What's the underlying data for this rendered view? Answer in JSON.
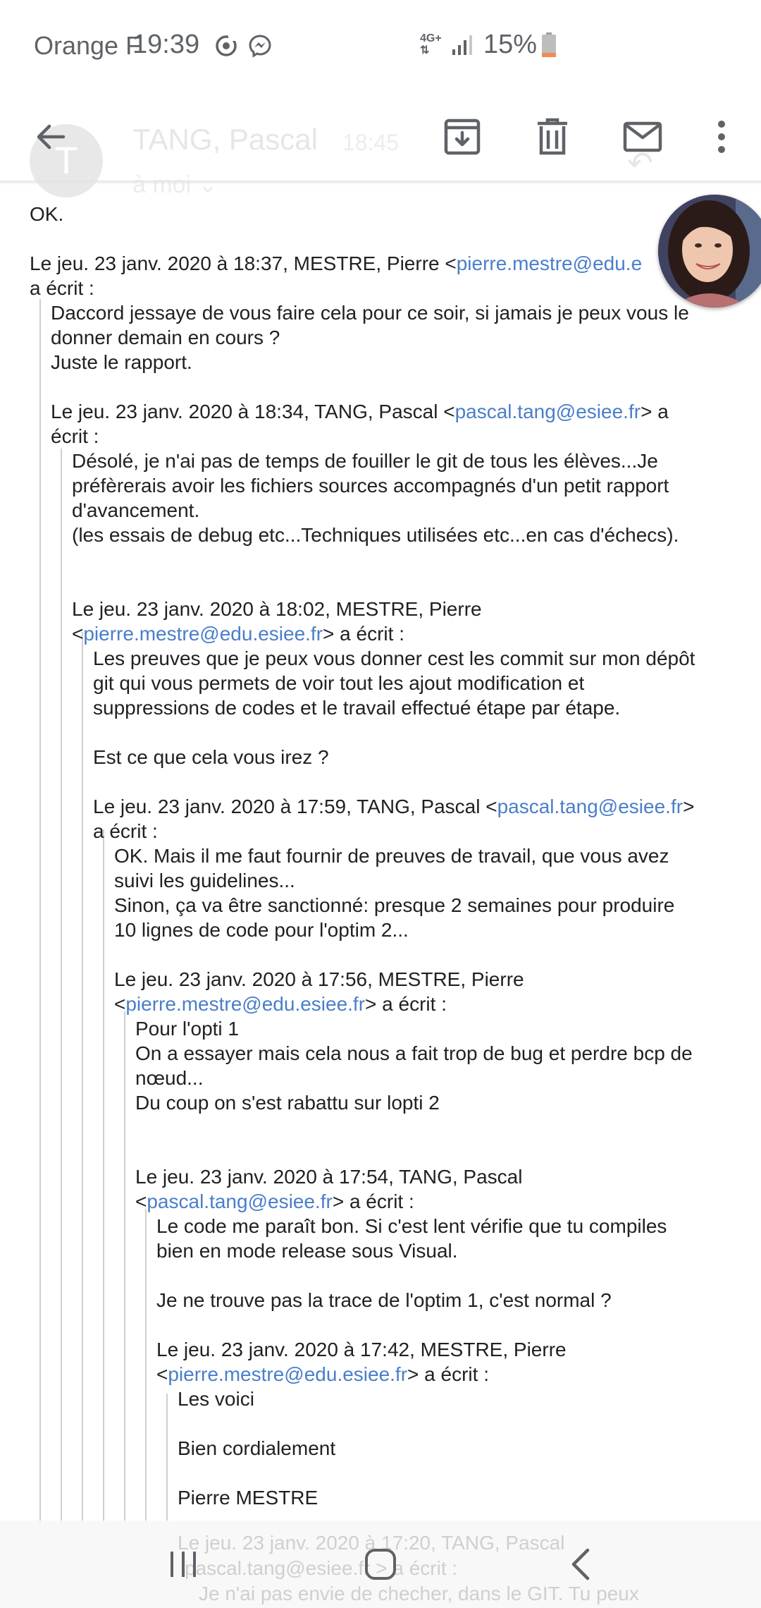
{
  "status_bar": {
    "carrier": "Orange F",
    "time": "19:39",
    "network": "4G+",
    "battery": "15%"
  },
  "faded_header": {
    "avatar_letter": "T",
    "sender": "TANG, Pascal",
    "time": "18:45",
    "to": "à moi"
  },
  "toolbar": {
    "back_icon": "arrow-back-icon",
    "archive_icon": "archive-icon",
    "delete_icon": "trash-icon",
    "unread_icon": "mail-icon",
    "more_icon": "more-vert-icon"
  },
  "email": {
    "l01": "OK.",
    "l02_text": "Le jeu. 23 janv. 2020 à 18:37, MESTRE, Pierre <",
    "l02_link": "pierre.mestre@edu.e",
    "l03": "a écrit :",
    "l04": "Daccord jessaye de vous faire cela pour ce soir, si jamais je peux vous le",
    "l05": "donner demain en cours ?",
    "l06": "Juste le rapport.",
    "l07_text": "Le jeu. 23 janv. 2020 à 18:34, TANG, Pascal <",
    "l07_link": "pascal.tang@esiee.fr",
    "l07_tail": "> a",
    "l08": "écrit :",
    "l09": "Désolé, je n'ai pas de temps de fouiller le git de tous les élèves...Je",
    "l10": "préfèrerais avoir les fichiers sources accompagnés d'un petit rapport",
    "l11": "d'avancement.",
    "l12": "(les essais de debug etc...Techniques utilisées etc...en cas d'échecs).",
    "l13": "Le jeu. 23 janv. 2020 à 18:02, MESTRE, Pierre",
    "l14_pre": "<",
    "l14_link": "pierre.mestre@edu.esiee.fr",
    "l14_tail": "> a écrit :",
    "l15": "Les preuves que je peux vous donner cest les commit sur mon dépôt",
    "l16": "git qui vous permets de voir tout les ajout modification et",
    "l17": "suppressions de codes et le travail effectué étape par étape.",
    "l18": "Est ce que cela vous irez ?",
    "l19_text": "Le jeu. 23 janv. 2020 à 17:59, TANG, Pascal <",
    "l19_link": "pascal.tang@esiee.fr",
    "l19_tail": ">",
    "l20": "a écrit :",
    "l21": "OK. Mais il me faut fournir de preuves de travail, que vous avez",
    "l22": "suivi les guidelines...",
    "l23": "Sinon, ça va être sanctionné: presque 2 semaines pour produire",
    "l24": "10 lignes de code pour l'optim 2...",
    "l25": "Le jeu. 23 janv. 2020 à 17:56, MESTRE, Pierre",
    "l26_pre": "<",
    "l26_link": "pierre.mestre@edu.esiee.fr",
    "l26_tail": "> a écrit :",
    "l27": "Pour l'opti 1",
    "l28": "On a essayer mais cela nous a fait trop de bug et perdre bcp de",
    "l29": "nœud...",
    "l30": "Du coup on s'est rabattu sur lopti 2",
    "l31": "Le jeu. 23 janv. 2020 à 17:54, TANG, Pascal",
    "l32_pre": "<",
    "l32_link": "pascal.tang@esiee.fr",
    "l32_tail": "> a écrit :",
    "l33": "Le code me paraît bon. Si c'est lent vérifie que tu compiles",
    "l34": "bien en mode release sous Visual.",
    "l35": "Je ne trouve pas la trace de l'optim 1, c'est normal ?",
    "l36": "Le jeu. 23 janv. 2020 à 17:42, MESTRE, Pierre",
    "l37_pre": "<",
    "l37_link": "pierre.mestre@edu.esiee.fr",
    "l37_tail": "> a écrit :",
    "l38": "Les voici",
    "l39": "Bien cordialement",
    "l40": "Pierre MESTRE",
    "l41": "Le jeu. 23 janv. 2020 à 17:20, TANG, Pascal",
    "l42_link": "pascal.tang@esiee.fr",
    "l42_tail": "> a écrit :",
    "l43": "Je n'ai pas envie de checher, dans le GIT. Tu peux"
  },
  "chat_head": {
    "icon": "messenger-chat-head-avatar"
  },
  "nav_bar": {
    "recents_icon": "recents-icon",
    "home_icon": "home-icon",
    "back_icon": "nav-back-icon"
  }
}
